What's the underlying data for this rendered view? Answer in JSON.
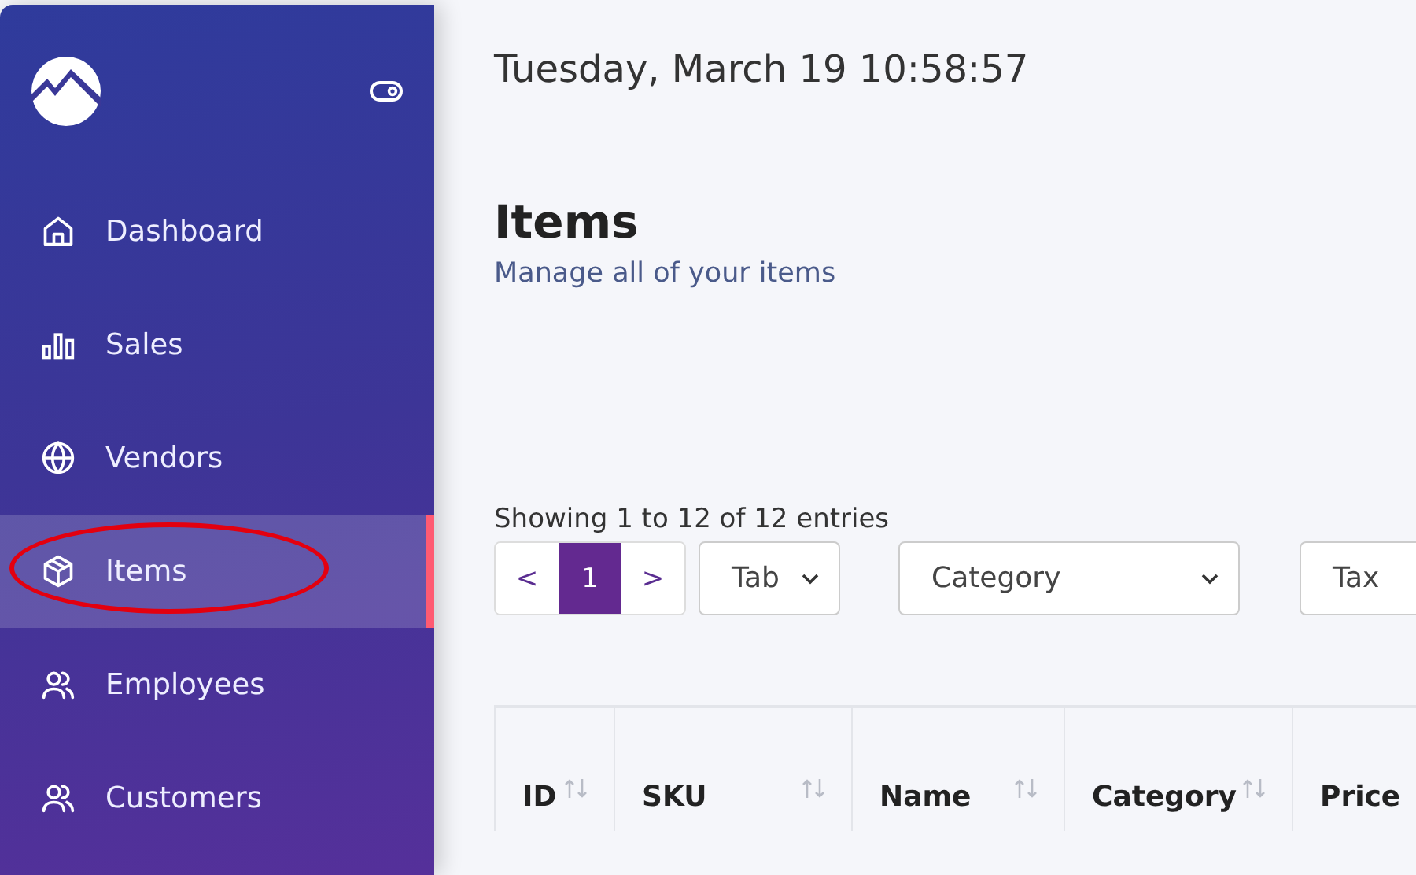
{
  "sidebar": {
    "items": [
      {
        "label": "Dashboard",
        "kind": "home",
        "selected": false
      },
      {
        "label": "Sales",
        "kind": "bars",
        "selected": false
      },
      {
        "label": "Vendors",
        "kind": "globe",
        "selected": false
      },
      {
        "label": "Items",
        "kind": "box",
        "selected": true
      },
      {
        "label": "Employees",
        "kind": "users",
        "selected": false
      },
      {
        "label": "Customers",
        "kind": "users",
        "selected": false
      }
    ]
  },
  "datetime": "Tuesday, March 19 10:58:57",
  "page": {
    "title": "Items",
    "subtitle": "Manage all of your items"
  },
  "table_info": "Showing 1 to 12 of 12 entries",
  "pagination": {
    "prev": "<",
    "pages": [
      {
        "label": "1",
        "selected": true
      }
    ],
    "next": ">"
  },
  "filters": [
    {
      "label": "Tab",
      "kind": "select"
    },
    {
      "label": "Category",
      "kind": "select"
    },
    {
      "label": "Tax",
      "kind": "select"
    }
  ],
  "table": {
    "columns": [
      "ID",
      "SKU",
      "Name",
      "Category",
      "Price"
    ]
  }
}
